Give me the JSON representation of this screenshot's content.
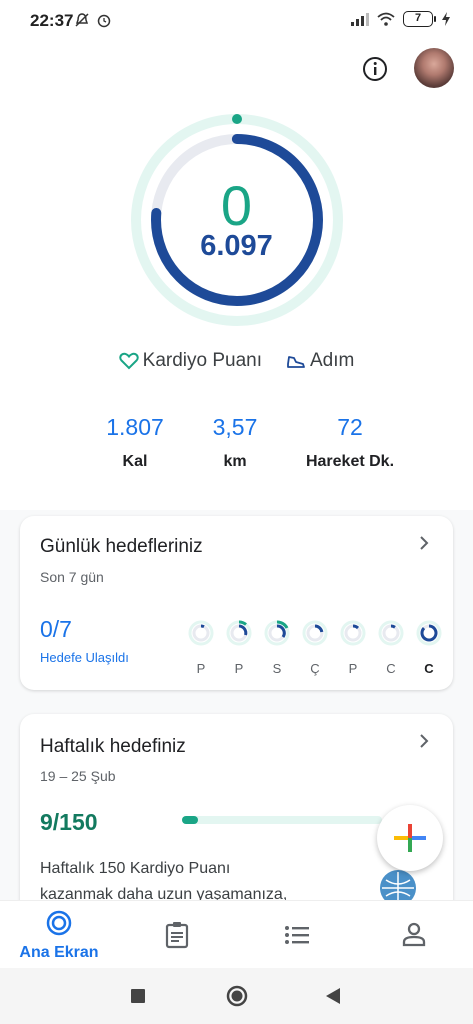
{
  "status_bar": {
    "time": "22:37",
    "battery": "7"
  },
  "ring": {
    "main_value": "0",
    "sub_value": "6.097"
  },
  "legend": {
    "cardio": "Kardiyo Puanı",
    "steps": "Adım"
  },
  "stats": [
    {
      "value": "1.807",
      "label": "Kal"
    },
    {
      "value": "3,57",
      "label": "km"
    },
    {
      "value": "72",
      "label": "Hareket Dk."
    }
  ],
  "daily_card": {
    "title": "Günlük hedefleriniz",
    "subtitle": "Son 7 gün",
    "count": "0/7",
    "count_label": "Hedefe Ulaşıldı",
    "days": [
      "P",
      "P",
      "S",
      "Ç",
      "P",
      "C",
      "C"
    ]
  },
  "weekly_card": {
    "title": "Haftalık hedefiniz",
    "subtitle": "19 – 25 Şub",
    "count": "9/150",
    "progress": 0.06,
    "desc_line1": "Haftalık 150 Kardiyo Puanı",
    "desc_line2": "kazanmak daha uzun yaşamanıza,"
  },
  "nav": {
    "home_label": "Ana Ekran"
  },
  "icons": [
    "mute-icon",
    "alarm-icon",
    "signal-icon",
    "wifi-icon",
    "charging-icon",
    "info-icon",
    "heart-icon",
    "shoe-icon",
    "chevron-right-icon",
    "plus-icon",
    "who-logo-icon",
    "home-icon",
    "journal-icon",
    "list-icon",
    "profile-icon",
    "square-nav-icon",
    "circle-nav-icon",
    "back-nav-icon"
  ],
  "colors": {
    "teal": "#1aa586",
    "blue": "#1a73e8",
    "navy": "#1e4a98"
  }
}
